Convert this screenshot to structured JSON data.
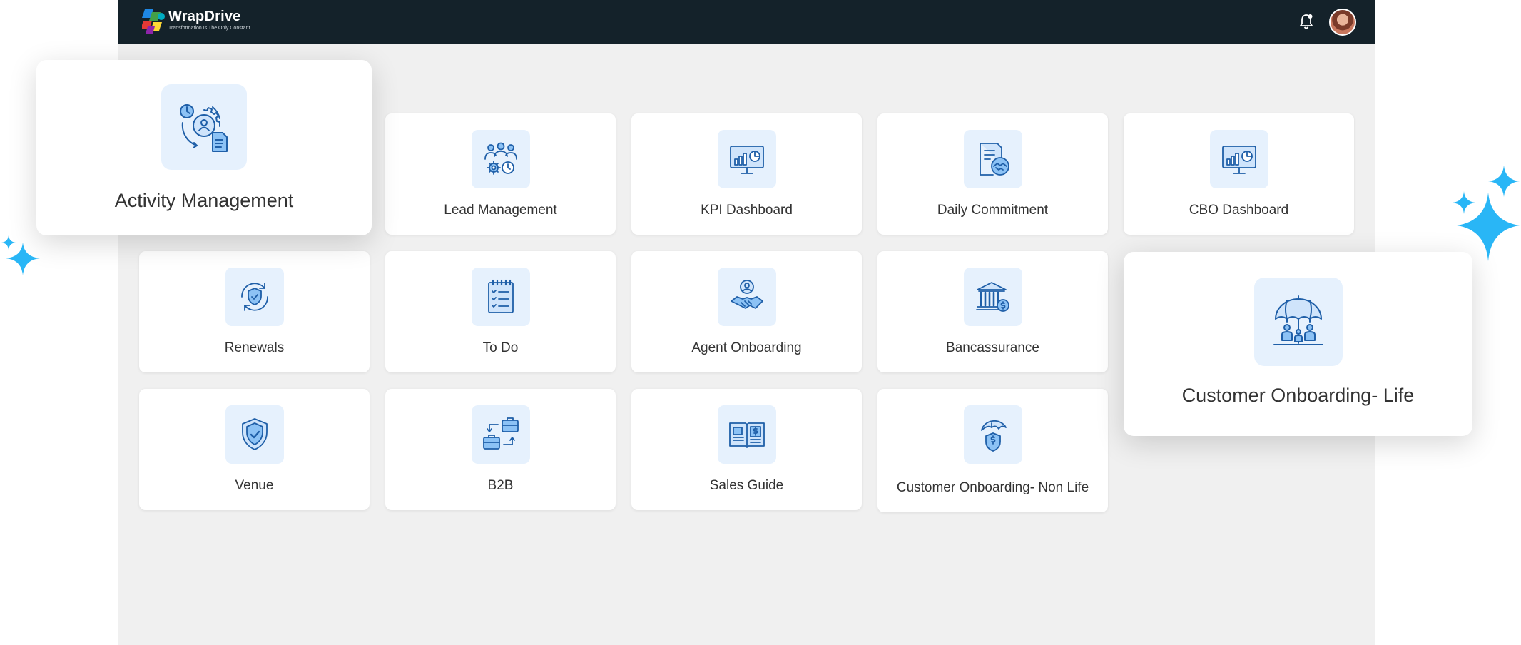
{
  "app": {
    "brand_name": "WrapDrive",
    "brand_tagline": "Transformation Is The Only Constant"
  },
  "header": {
    "icons": [
      "notification-bell-icon",
      "user-avatar"
    ]
  },
  "tiles": {
    "activity_management": {
      "label": "Activity Management",
      "icon": "gear-user-document-icon"
    },
    "lead_management": {
      "label": "Lead Management",
      "icon": "team-settings-icon"
    },
    "kpi_dashboard": {
      "label": "KPI Dashboard",
      "icon": "monitor-chart-icon"
    },
    "daily_commitment": {
      "label": "Daily Commitment",
      "icon": "document-handshake-icon"
    },
    "cbo_dashboard": {
      "label": "CBO Dashboard",
      "icon": "monitor-chart-icon"
    },
    "renewals": {
      "label": "Renewals",
      "icon": "shield-refresh-icon"
    },
    "to_do": {
      "label": "To Do",
      "icon": "checklist-notepad-icon"
    },
    "agent_onboarding": {
      "label": "Agent Onboarding",
      "icon": "person-handshake-icon"
    },
    "bancassurance": {
      "label": "Bancassurance",
      "icon": "bank-dollar-icon"
    },
    "customer_onboarding_life": {
      "label": "Customer Onboarding- Life",
      "icon": "umbrella-family-icon"
    },
    "venue": {
      "label": "Venue",
      "icon": "shield-check-icon"
    },
    "b2b": {
      "label": "B2B",
      "icon": "briefcase-exchange-icon"
    },
    "sales_guide": {
      "label": "Sales Guide",
      "icon": "open-book-dollar-icon"
    },
    "customer_onboarding_non_life": {
      "label": "Customer Onboarding- Non Life",
      "icon": "umbrella-shield-dollar-icon"
    }
  },
  "colors": {
    "header_bg": "#14222a",
    "content_bg": "#f0f0f0",
    "icon_tile_bg": "#e6f1fd",
    "icon_stroke": "#1f5fa8",
    "icon_fill": "#8cc2f5",
    "sparkle": "#29b6f6"
  }
}
